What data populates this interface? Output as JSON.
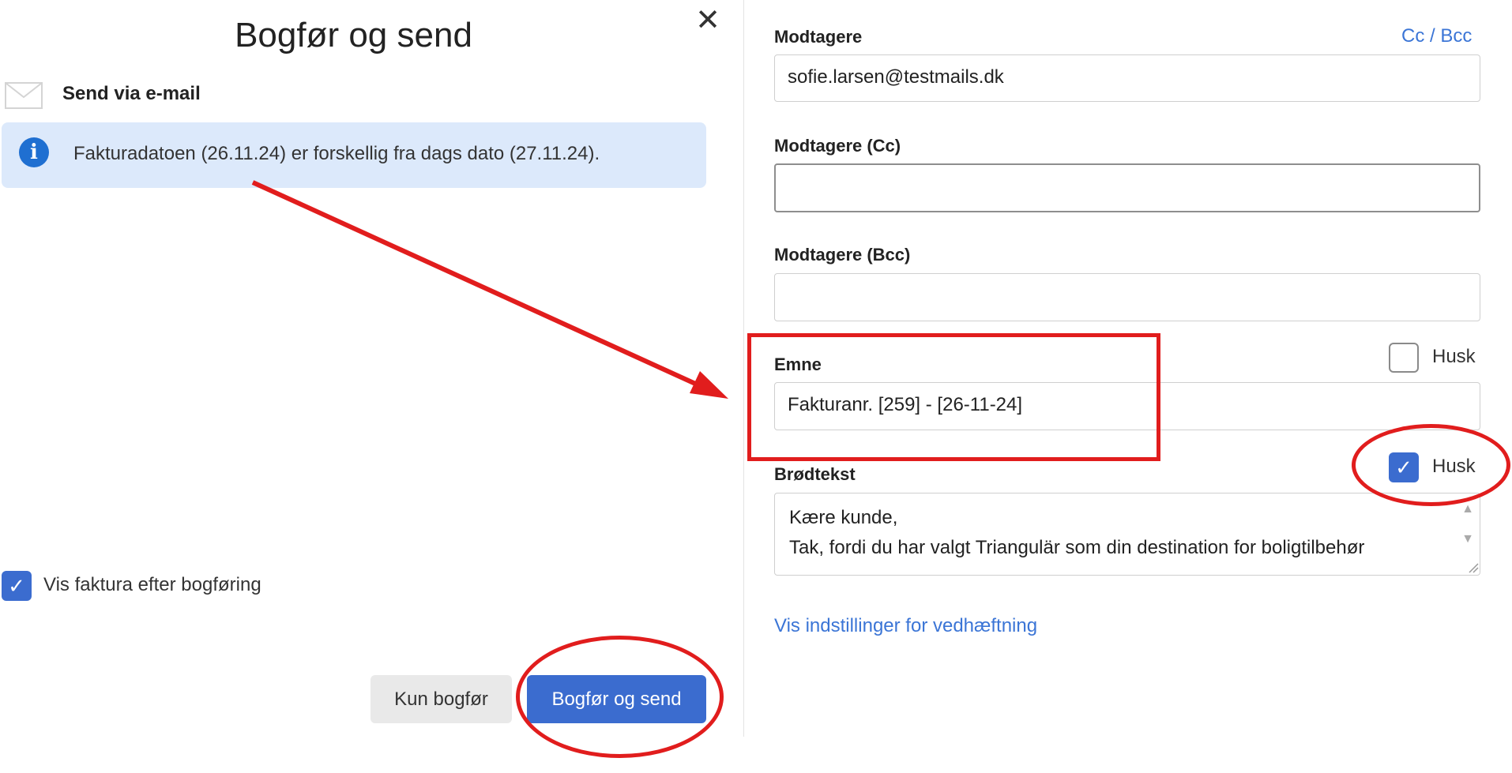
{
  "dialog": {
    "title": "Bogfør og send",
    "close_icon": "close-icon",
    "section_label": "Send via e-mail",
    "section_icon": "mail-icon",
    "info": {
      "icon": "info-icon",
      "text": "Fakturadatoen (26.11.24) er forskellig fra dags dato (27.11.24)."
    },
    "show_invoice": {
      "label": "Vis faktura efter bogføring",
      "checked": true
    },
    "buttons": {
      "secondary": "Kun bogfør",
      "primary": "Bogfør og send"
    }
  },
  "form": {
    "recipients": {
      "label": "Modtagere",
      "cc_bcc_link": "Cc / Bcc",
      "value": "sofie.larsen@testmails.dk"
    },
    "cc": {
      "label": "Modtagere (Cc)",
      "value": ""
    },
    "bcc": {
      "label": "Modtagere (Bcc)",
      "value": ""
    },
    "subject": {
      "label": "Emne",
      "value": "Fakturanr. [259] - [26-11-24]",
      "remember_label": "Husk",
      "remember_checked": false
    },
    "body": {
      "label": "Brødtekst",
      "line1": "Kære kunde,",
      "line2": "Tak, fordi du har valgt Triangulär som din destination for boligtilbehør",
      "remember_label": "Husk",
      "remember_checked": true
    },
    "attachment_link": "Vis indstillinger for vedhæftning"
  },
  "colors": {
    "primary": "#3b6ccf",
    "info_bg": "#dce9fb",
    "info_icon": "#1f6fd1",
    "link": "#3b75d6",
    "annotation": "#e11d1d"
  }
}
